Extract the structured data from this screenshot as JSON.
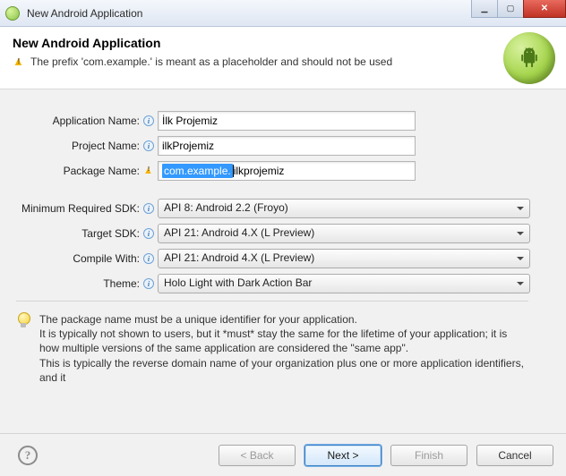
{
  "titlebar": {
    "title": "New Android Application"
  },
  "header": {
    "heading": "New Android Application",
    "message": "The prefix 'com.example.' is meant as a placeholder and should not be used"
  },
  "fields": {
    "appName": {
      "label": "Application Name:",
      "value": "İlk Projemiz"
    },
    "projName": {
      "label": "Project Name:",
      "value": "ilkProjemiz"
    },
    "pkgName": {
      "label": "Package Name:",
      "selected": "com.example.",
      "rest": "ilkprojemiz"
    },
    "minSdk": {
      "label": "Minimum Required SDK:",
      "value": "API 8: Android 2.2 (Froyo)"
    },
    "targetSdk": {
      "label": "Target SDK:",
      "value": "API 21: Android 4.X (L Preview)"
    },
    "compile": {
      "label": "Compile With:",
      "value": "API 21: Android 4.X (L Preview)"
    },
    "theme": {
      "label": "Theme:",
      "value": "Holo Light with Dark Action Bar"
    }
  },
  "hint": {
    "line1": "The package name must be a unique identifier for your application.",
    "line2": "It is typically not shown to users, but it *must* stay the same for the lifetime of your application; it is how multiple versions of the same application are considered the \"same app\".",
    "line3": "This is typically the reverse domain name of your organization plus one or more application identifiers, and it"
  },
  "buttons": {
    "back": "< Back",
    "next": "Next >",
    "finish": "Finish",
    "cancel": "Cancel"
  }
}
